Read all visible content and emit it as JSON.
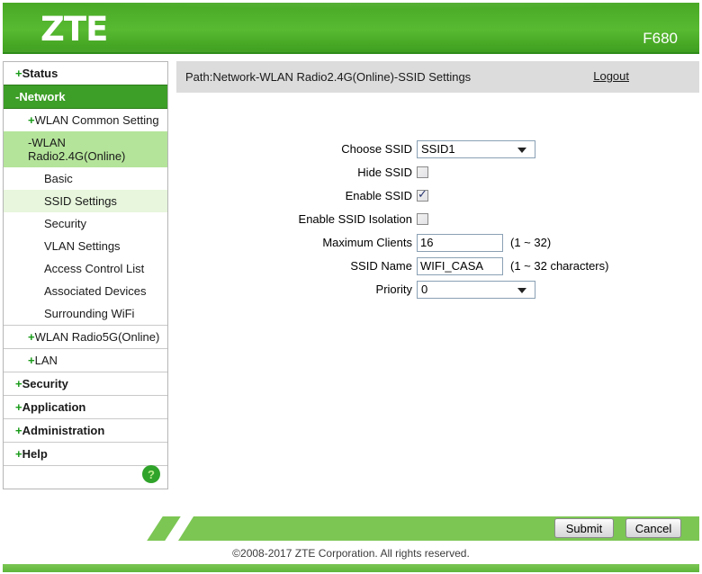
{
  "header": {
    "logo": "ZTE",
    "model": "F680"
  },
  "pathbar": {
    "path": "Path:Network-WLAN Radio2.4G(Online)-SSID Settings",
    "logout": "Logout"
  },
  "sidebar": {
    "items": [
      {
        "prefix": "+",
        "label": "Status"
      },
      {
        "prefix": "-",
        "label": "Network"
      },
      {
        "prefix": "+",
        "label": "WLAN Common Setting"
      },
      {
        "prefix": "-",
        "label": "WLAN Radio2.4G(Online)"
      },
      {
        "label": "Basic"
      },
      {
        "label": "SSID Settings"
      },
      {
        "label": "Security"
      },
      {
        "label": "VLAN Settings"
      },
      {
        "label": "Access Control List"
      },
      {
        "label": "Associated Devices"
      },
      {
        "label": "Surrounding WiFi"
      },
      {
        "prefix": "+",
        "label": "WLAN Radio5G(Online)"
      },
      {
        "prefix": "+",
        "label": "LAN"
      },
      {
        "prefix": "+",
        "label": "Security"
      },
      {
        "prefix": "+",
        "label": "Application"
      },
      {
        "prefix": "+",
        "label": "Administration"
      },
      {
        "prefix": "+",
        "label": "Help"
      }
    ],
    "help_icon": "?"
  },
  "form": {
    "rows": [
      {
        "label": "Choose SSID",
        "control": "select",
        "value": "SSID1"
      },
      {
        "label": "Hide SSID",
        "control": "checkbox",
        "checked": false
      },
      {
        "label": "Enable SSID",
        "control": "checkbox",
        "checked": true
      },
      {
        "label": "Enable SSID Isolation",
        "control": "checkbox",
        "checked": false
      },
      {
        "label": "Maximum Clients",
        "control": "text",
        "value": "16",
        "hint": "(1 ~ 32)"
      },
      {
        "label": "SSID Name",
        "control": "text",
        "value": "WIFI_CASA",
        "hint": "(1 ~ 32 characters)"
      },
      {
        "label": "Priority",
        "control": "select",
        "value": "0"
      }
    ]
  },
  "footer": {
    "submit": "Submit",
    "cancel": "Cancel",
    "copyright": "©2008-2017 ZTE Corporation. All rights reserved."
  },
  "icons": {
    "check": "✓"
  },
  "colors": {
    "brand_green": "#57ba31",
    "nav_active_green": "#3d9e28",
    "nav_light_green": "#b4e49a",
    "nav_pale_green": "#e7f6dc",
    "footer_bar_green": "#7cc654",
    "pathbar_gray": "#dcdcdc",
    "check_navy": "#27356f"
  }
}
